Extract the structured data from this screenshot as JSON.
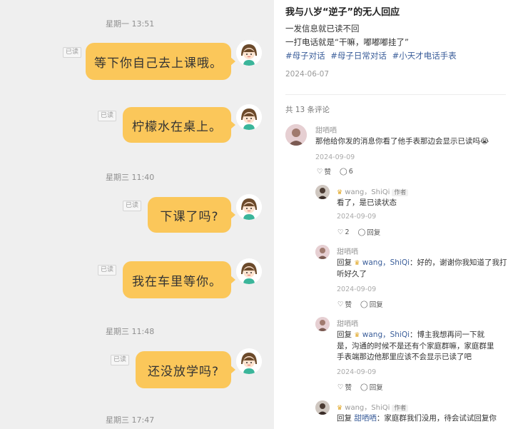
{
  "chat": {
    "messages": [
      {
        "timestamp": "星期一 13:51",
        "read": "已读",
        "text": "等下你自己去上课哦。"
      },
      {
        "read": "已读",
        "text": "柠檬水在桌上。"
      },
      {
        "timestamp": "星期三 11:40",
        "read": "已读",
        "text": "下课了吗?"
      },
      {
        "read": "已读",
        "text": "我在车里等你。"
      },
      {
        "timestamp": "星期三 11:48",
        "read": "已读",
        "text": "还没放学吗?"
      },
      {
        "timestamp": "星期三 17:47"
      }
    ]
  },
  "post": {
    "title": "我与八岁“逆子”的无人回应",
    "body": [
      "一发信息就已读不回",
      "一打电话就是“干嘛，嘟嘟嘟挂了”"
    ],
    "tags": [
      "#母子对话",
      "#母子日常对话",
      "#小天才电话手表"
    ],
    "date": "2024-06-07",
    "comment_count": "共 13 条评论",
    "comments": [
      {
        "user": "甜哂哂",
        "text": "那他给你发的消息你看了他手表那边会显示已读吗",
        "emoji": "😭",
        "date": "2024-09-09",
        "like_label": "赞",
        "reply_count": "6"
      },
      {
        "user": "wang，ShiQi",
        "badge": "作者",
        "text": "看了，是已读状态",
        "date": "2024-09-09",
        "like_count": "2",
        "reply_label": "回复"
      },
      {
        "user": "甜哂哂",
        "reply_prefix": "回复",
        "reply_to": "wang，ShiQi",
        "text_a": "：好的，谢谢你",
        "text_b": "我知道了我打听好久了",
        "date": "2024-09-09",
        "like_label": "赞",
        "reply_label": "回复"
      },
      {
        "user": "甜哂哂",
        "reply_prefix": "回复",
        "reply_to": "wang，ShiQi",
        "lines": [
          "：博主我想再问一下就",
          "是，沟通的时候不是还有个家庭群嘛，家庭群里",
          "手表端那边他那里应该不会显示已读了吧"
        ],
        "date": "2024-09-09",
        "like_label": "赞",
        "reply_label": "回复"
      },
      {
        "user": "wang，ShiQi",
        "badge": "作者",
        "reply_prefix": "回复",
        "reply_to": "甜哂哂",
        "text": "：家庭群我们没用，待会试试回复你"
      }
    ]
  },
  "colors": {
    "bubble": "#fbc75a",
    "chat_bg": "#efefef",
    "tag": "#3b5e9a"
  }
}
